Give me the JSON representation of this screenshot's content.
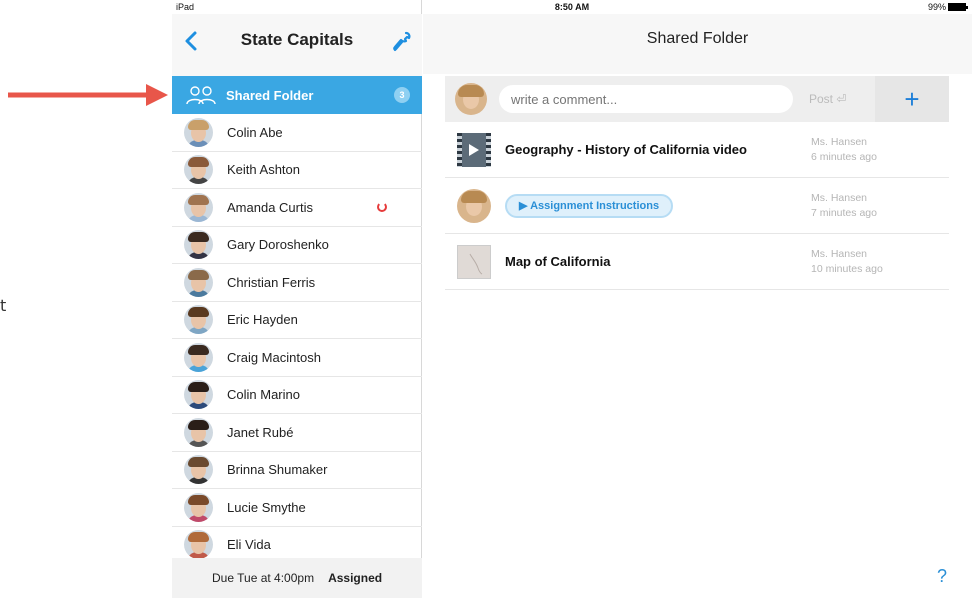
{
  "edge_text": "t",
  "statusbar": {
    "device": "iPad",
    "time": "8:50 AM",
    "battery": "99%"
  },
  "sidebar": {
    "title": "State Capitals",
    "shared_folder": {
      "label": "Shared Folder",
      "count": "3"
    },
    "students": [
      {
        "name": "Colin Abe",
        "hair": "#c9a06a",
        "shirt": "#6b8fb8"
      },
      {
        "name": "Keith Ashton",
        "hair": "#8a5a3a",
        "shirt": "#444"
      },
      {
        "name": "Amanda Curtis",
        "hair": "#a07450",
        "shirt": "#9bb7d4",
        "status": "in-progress"
      },
      {
        "name": "Gary Doroshenko",
        "hair": "#3a2a20",
        "shirt": "#334"
      },
      {
        "name": "Christian Ferris",
        "hair": "#8a6a4a",
        "shirt": "#4b7a9e"
      },
      {
        "name": "Eric Hayden",
        "hair": "#5a3a20",
        "shirt": "#7fa6c4"
      },
      {
        "name": "Craig Macintosh",
        "hair": "#3a2a20",
        "shirt": "#4aa3d8"
      },
      {
        "name": "Colin Marino",
        "hair": "#2a1e18",
        "shirt": "#2c4a7a"
      },
      {
        "name": "Janet Rubé",
        "hair": "#2a1e18",
        "shirt": "#555"
      },
      {
        "name": "Brinna Shumaker",
        "hair": "#6a4a30",
        "shirt": "#333"
      },
      {
        "name": "Lucie Smythe",
        "hair": "#7a4a2a",
        "shirt": "#c04a6a"
      },
      {
        "name": "Eli Vida",
        "hair": "#b06a3a",
        "shirt": "#c05a4a"
      }
    ],
    "footer": {
      "due": "Due Tue at 4:00pm",
      "status": "Assigned"
    }
  },
  "main": {
    "title": "Shared Folder",
    "compose": {
      "placeholder": "write a comment...",
      "post_label": "Post ⏎",
      "add_label": "+"
    },
    "feed": [
      {
        "type": "video",
        "title": "Geography - History of California video",
        "author": "Ms. Hansen",
        "time": "6 minutes ago"
      },
      {
        "type": "audio",
        "title": "▶ Assignment Instructions",
        "author": "Ms. Hansen",
        "time": "7 minutes ago"
      },
      {
        "type": "image",
        "title": "Map of California",
        "author": "Ms. Hansen",
        "time": "10 minutes ago"
      }
    ],
    "help_label": "?"
  },
  "colors": {
    "accent": "#3aa7e3",
    "annotation_arrow": "#e8564a",
    "status_ring": "#e63b3b"
  }
}
